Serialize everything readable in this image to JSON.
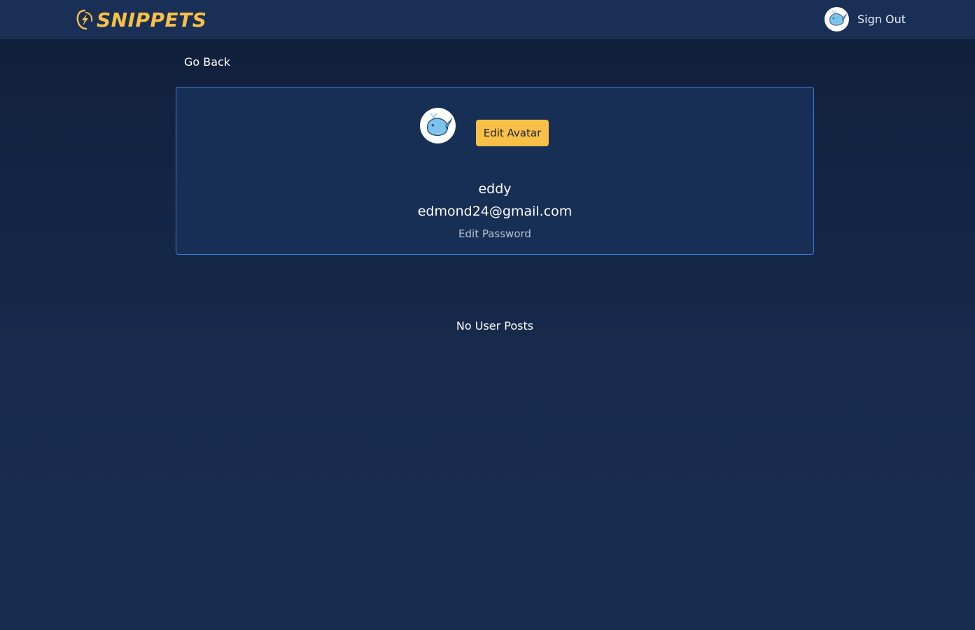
{
  "header": {
    "brand_name": "SNIPPETS",
    "brand_icon": "lightning-swirl-logo-icon",
    "brand_color": "#f8c047",
    "user_avatar_icon": "whale-avatar-icon",
    "sign_out_label": "Sign Out"
  },
  "nav": {
    "go_back_label": "Go Back"
  },
  "profile": {
    "avatar_icon": "whale-avatar-icon",
    "edit_avatar_label": "Edit Avatar",
    "username": "eddy",
    "email": "edmond24@gmail.com",
    "edit_password_label": "Edit Password"
  },
  "posts": {
    "empty_message": "No User Posts"
  },
  "colors": {
    "background": "#142647",
    "navbar": "#1a2f55",
    "card": "#182f55",
    "card_border": "#3b7be0",
    "accent": "#f8c047"
  }
}
